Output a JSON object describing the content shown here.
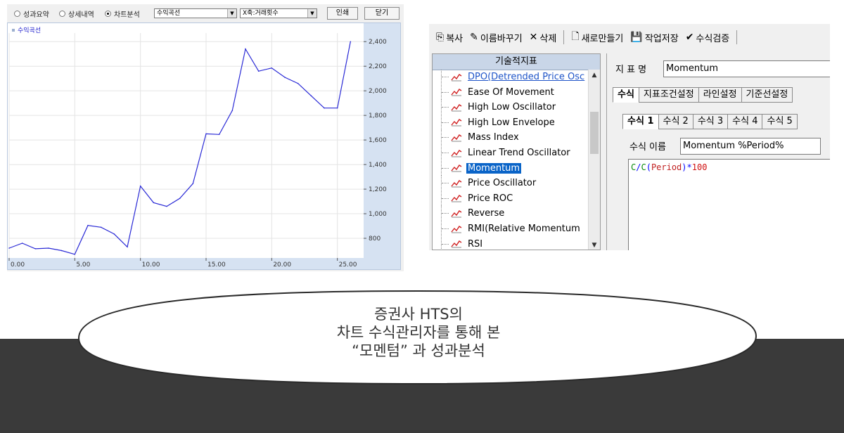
{
  "perf_window": {
    "radios": [
      {
        "label": "성과요약",
        "selected": false
      },
      {
        "label": "상세내역",
        "selected": false
      },
      {
        "label": "차트분석",
        "selected": true
      }
    ],
    "chart_select": "수익곡선",
    "axis_select": "X축:거래횟수",
    "print_button": "인쇄",
    "close_button": "닫기",
    "legend": "수익곡선",
    "colors": {
      "line": "#2b2bd6",
      "axis_band": "#d6e2f2",
      "grid": "#e4e4e4"
    }
  },
  "chart_data": {
    "type": "line",
    "title": "",
    "xlabel": "",
    "ylabel": "",
    "legend": "수익곡선",
    "x_ticks": [
      "0.00",
      "5.00",
      "10.00",
      "15.00",
      "20.00",
      "25.00"
    ],
    "y_ticks": [
      "800",
      "1,000",
      "1,200",
      "1,400",
      "1,600",
      "1,800",
      "2,000",
      "2,200",
      "2,400"
    ],
    "xlim": [
      0,
      27
    ],
    "ylim": [
      640,
      2470
    ],
    "grid": true,
    "series": [
      {
        "name": "수익곡선",
        "x": [
          0,
          1,
          2,
          3,
          4,
          5,
          6,
          7,
          8,
          9,
          10,
          11,
          12,
          13,
          14,
          15,
          16,
          17,
          18,
          19,
          20,
          21,
          22,
          23,
          24,
          25,
          26
        ],
        "y": [
          720,
          760,
          715,
          720,
          700,
          670,
          905,
          890,
          835,
          730,
          1225,
          1090,
          1060,
          1125,
          1245,
          1650,
          1645,
          1840,
          2340,
          2160,
          2185,
          2110,
          2060,
          1960,
          1860,
          1860,
          2400
        ]
      }
    ]
  },
  "formula_manager": {
    "toolbar": [
      {
        "icon": "copy-icon",
        "glyph": "⎘",
        "label": "복사"
      },
      {
        "icon": "rename-icon",
        "glyph": "✎",
        "label": "이름바꾸기"
      },
      {
        "icon": "delete-icon",
        "glyph": "✕",
        "label": "삭제"
      },
      {
        "icon": "new-icon",
        "glyph": "🗋",
        "label": "새로만들기"
      },
      {
        "icon": "save-icon",
        "glyph": "💾",
        "label": "작업저장"
      },
      {
        "icon": "check-icon",
        "glyph": "✔",
        "label": "수식검증"
      }
    ],
    "list_header": "기술적지표",
    "indicators": [
      "DPO(Detrended Price Osc",
      "Ease Of Movement",
      "High Low Oscillator",
      "High Low Envelope",
      "Mass Index",
      "Linear Trend Oscillator",
      "Momentum",
      "Price Oscillator",
      "Price ROC",
      "Reverse",
      "RMI(Relative Momentum",
      "RSI"
    ],
    "selected_indicator": "Momentum",
    "name_label": "지 표 명",
    "name_value": "Momentum",
    "main_tabs": [
      "수식",
      "지표조건설정",
      "라인설정",
      "기준선설정"
    ],
    "formula_tabs": [
      "수식 1",
      "수식 2",
      "수식 3",
      "수식 4",
      "수식 5"
    ],
    "formula_name_label": "수식 이름",
    "formula_name_value": "Momentum %Period%",
    "formula_tokens": [
      {
        "text": "C",
        "cls": "tok-green"
      },
      {
        "text": "/",
        "cls": "tok-blue"
      },
      {
        "text": "C",
        "cls": "tok-green"
      },
      {
        "text": "(",
        "cls": "tok-blue"
      },
      {
        "text": "Period",
        "cls": "tok-darkred"
      },
      {
        "text": ")",
        "cls": "tok-blue"
      },
      {
        "text": "*",
        "cls": "tok-blue"
      },
      {
        "text": "100",
        "cls": "tok-red"
      }
    ]
  },
  "caption": {
    "line1": "증권사 HTS의",
    "line2": "차트 수식관리자를 통해 본",
    "line3": "“모멘텀” 과 성과분석"
  }
}
